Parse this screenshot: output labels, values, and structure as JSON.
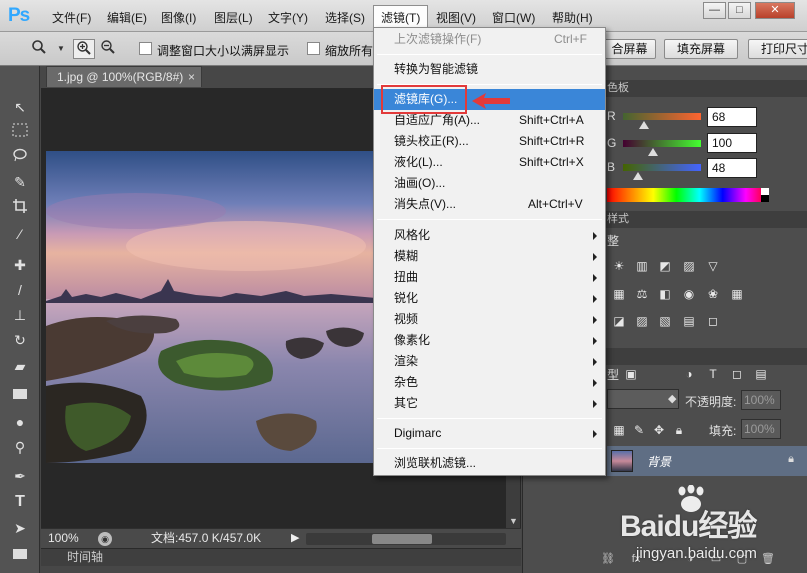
{
  "app": {
    "logo": "Ps"
  },
  "menubar": {
    "items": [
      {
        "label": "文件(F)"
      },
      {
        "label": "编辑(E)"
      },
      {
        "label": "图像(I)"
      },
      {
        "label": "图层(L)"
      },
      {
        "label": "文字(Y)"
      },
      {
        "label": "选择(S)"
      },
      {
        "label": "滤镜(T)"
      },
      {
        "label": "视图(V)"
      },
      {
        "label": "窗口(W)"
      },
      {
        "label": "帮助(H)"
      }
    ],
    "window_buttons": {
      "minimize": "—",
      "maximize": "□",
      "close": "✕"
    }
  },
  "options_bar": {
    "resize_windows_label": "调整窗口大小以满屏显示",
    "zoom_all_label": "缩放所有",
    "fit_screen_button": "合屏幕",
    "fill_screen_button": "填充屏幕",
    "print_size_button": "打印尺寸"
  },
  "document": {
    "tab_title": "1.jpg @ 100%(RGB/8#)",
    "tab_close": "×",
    "zoom": "100%",
    "doc_size": "文档:457.0 K/457.0K",
    "timeline_label": "时间轴"
  },
  "filter_menu": {
    "items": [
      {
        "label": "上次滤镜操作(F)",
        "shortcut": "Ctrl+F",
        "disabled": true
      },
      {
        "label": "转换为智能滤镜"
      },
      {
        "label": "滤镜库(G)...",
        "highlighted": true
      },
      {
        "label": "自适应广角(A)...",
        "shortcut": "Shift+Ctrl+A"
      },
      {
        "label": "镜头校正(R)...",
        "shortcut": "Shift+Ctrl+R"
      },
      {
        "label": "液化(L)...",
        "shortcut": "Shift+Ctrl+X"
      },
      {
        "label": "油画(O)..."
      },
      {
        "label": "消失点(V)...",
        "shortcut": "Alt+Ctrl+V"
      },
      {
        "label": "风格化",
        "submenu": true
      },
      {
        "label": "模糊",
        "submenu": true
      },
      {
        "label": "扭曲",
        "submenu": true
      },
      {
        "label": "锐化",
        "submenu": true
      },
      {
        "label": "视频",
        "submenu": true
      },
      {
        "label": "像素化",
        "submenu": true
      },
      {
        "label": "渲染",
        "submenu": true
      },
      {
        "label": "杂色",
        "submenu": true
      },
      {
        "label": "其它",
        "submenu": true
      },
      {
        "label": "Digimarc",
        "submenu": true
      },
      {
        "label": "浏览联机滤镜..."
      }
    ]
  },
  "color_panel": {
    "title": "色板",
    "channels": [
      {
        "label": "R",
        "value": "68",
        "fraction": 0.27
      },
      {
        "label": "G",
        "value": "100",
        "fraction": 0.39
      },
      {
        "label": "B",
        "value": "48",
        "fraction": 0.19
      }
    ]
  },
  "styles_panel": {
    "title": "样式",
    "adjust_label": "整"
  },
  "layers_panel": {
    "kind_label": "型",
    "opacity_label": "不透明度:",
    "opacity_value": "100%",
    "fill_label": "填充:",
    "fill_value": "100%",
    "layer_name": "背景"
  },
  "watermark": {
    "main": "Baidu经验",
    "url": "jingyan.baidu.com"
  },
  "colors": {
    "highlight": "#3a86d8",
    "annotation_red": "#e23a3a",
    "accent_blue": "#31a8ff"
  }
}
